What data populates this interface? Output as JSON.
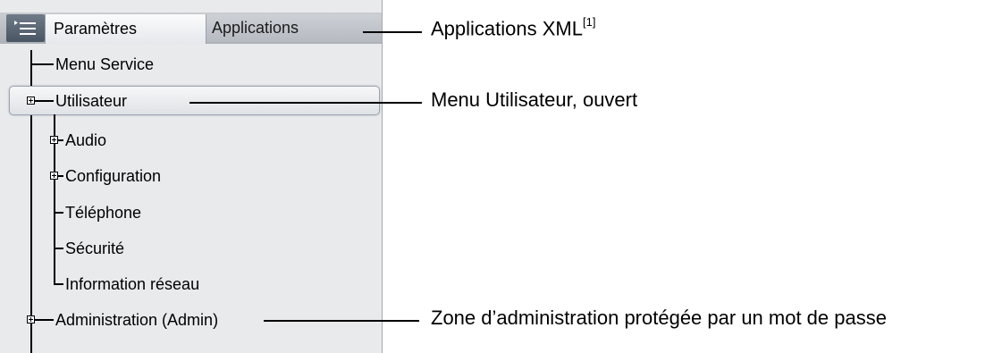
{
  "tabs": {
    "settings_label": "Paramètres",
    "apps_label": "Applications"
  },
  "tree": {
    "menu_service": "Menu Service",
    "user": "Utilisateur",
    "audio": "Audio",
    "configuration": "Configuration",
    "telephone": "Téléphone",
    "security": "Sécurité",
    "network_info": "Information réseau",
    "admin": "Administration (Admin)"
  },
  "callouts": {
    "xml_apps": "Applications XML",
    "xml_apps_ref": "[1]",
    "user_menu": "Menu Utilisateur, ouvert",
    "admin_zone": "Zone d’administration protégée par un mot de passe"
  },
  "icons": {
    "menu": "menu-icon",
    "expand": "plus-box-icon"
  },
  "colors": {
    "panel_bg": "#e9eaec",
    "menu_button": "#56616f",
    "highlight_border": "#9aa5b3"
  }
}
